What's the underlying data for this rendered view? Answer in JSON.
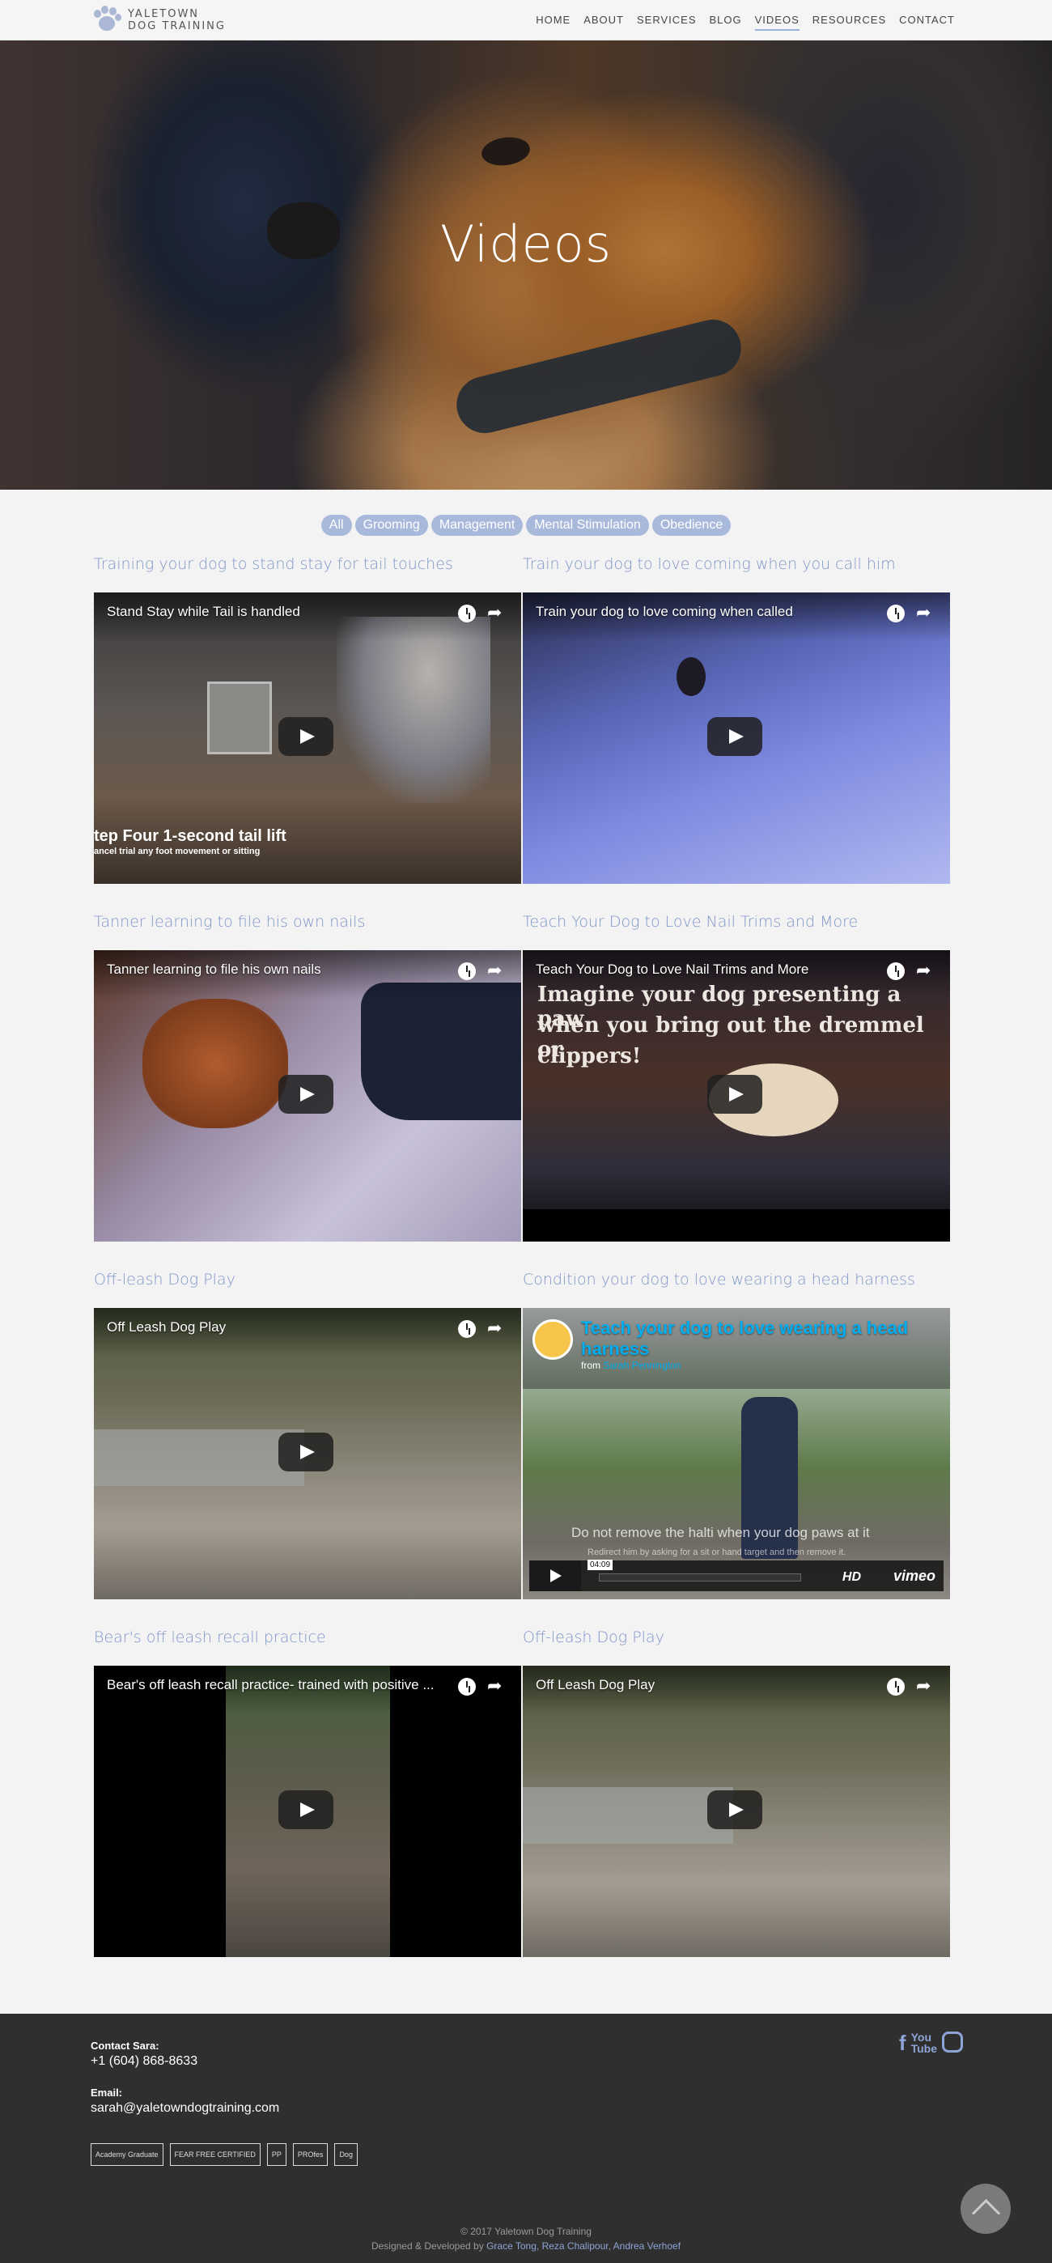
{
  "brand": {
    "line1": "YALETOWN",
    "line2": "DOG TRAINING"
  },
  "nav": {
    "items": [
      {
        "label": "HOME"
      },
      {
        "label": "ABOUT"
      },
      {
        "label": "SERVICES"
      },
      {
        "label": "BLOG"
      },
      {
        "label": "VIDEOS",
        "active": true
      },
      {
        "label": "RESOURCES"
      },
      {
        "label": "CONTACT"
      }
    ]
  },
  "hero": {
    "title": "Videos"
  },
  "filters": [
    "All",
    "Grooming",
    "Management",
    "Mental Stimulation",
    "Obedience"
  ],
  "videos": [
    {
      "heading": "Training your dog to stand stay for tail touches",
      "player_title": "Stand Stay while Tail is handled",
      "overlay_line1": "tep Four 1-second tail lift",
      "overlay_line2": "ancel trial any foot movement or sitting",
      "icon": "play-icon"
    },
    {
      "heading": "Train your dog to love coming when you call him",
      "player_title": "Train your dog to love coming when called",
      "icon": "play-icon"
    },
    {
      "heading": "Tanner learning to file his own nails",
      "player_title": "Tanner learning to file his own nails",
      "icon": "play-icon"
    },
    {
      "heading": "Teach Your Dog to Love Nail Trims and More",
      "player_title": "Teach Your Dog to Love Nail Trims and More",
      "overlay_line1": "Imagine your dog presenting a paw",
      "overlay_line2": "when you bring out the dremmel or",
      "overlay_line3": "clippers!",
      "icon": "play-icon"
    },
    {
      "heading": "Off-leash Dog Play",
      "player_title": "Off Leash Dog Play",
      "icon": "play-icon"
    },
    {
      "heading": "Condition your dog to love wearing a head harness",
      "vimeo": {
        "title": "Teach your dog to love wearing a head harness",
        "from_label": "from",
        "author": "Sarah Pennington",
        "subtitle": "Do not remove the halti when your dog paws at it",
        "subtitle2": "Redirect him by asking for a sit or hand target and then remove it.",
        "time": "04:09",
        "hd": "HD",
        "logo": "vimeo"
      }
    },
    {
      "heading": "Bear's off leash recall practice",
      "player_title": "Bear's off leash recall practice- trained with positive ...",
      "icon": "play-icon"
    },
    {
      "heading": "Off-leash Dog Play",
      "player_title": "Off Leash Dog Play",
      "icon": "play-icon"
    }
  ],
  "footer": {
    "contact_label": "Contact Sara:",
    "phone": "+1 (604) 868-8633",
    "email_label": "Email:",
    "email": "sarah@yaletowndogtraining.com",
    "badges": [
      "Academy Graduate",
      "FEAR FREE CERTIFIED",
      "PP",
      "PROfes",
      "Dog"
    ],
    "social": [
      "facebook-icon",
      "youtube-icon",
      "instagram-icon"
    ],
    "copyright": "© 2017 Yaletown Dog Training",
    "credits_prefix": "Designed & Developed by",
    "credits": [
      "Grace Tong",
      "Reza Chalipour",
      "Andrea Verhoef"
    ]
  }
}
